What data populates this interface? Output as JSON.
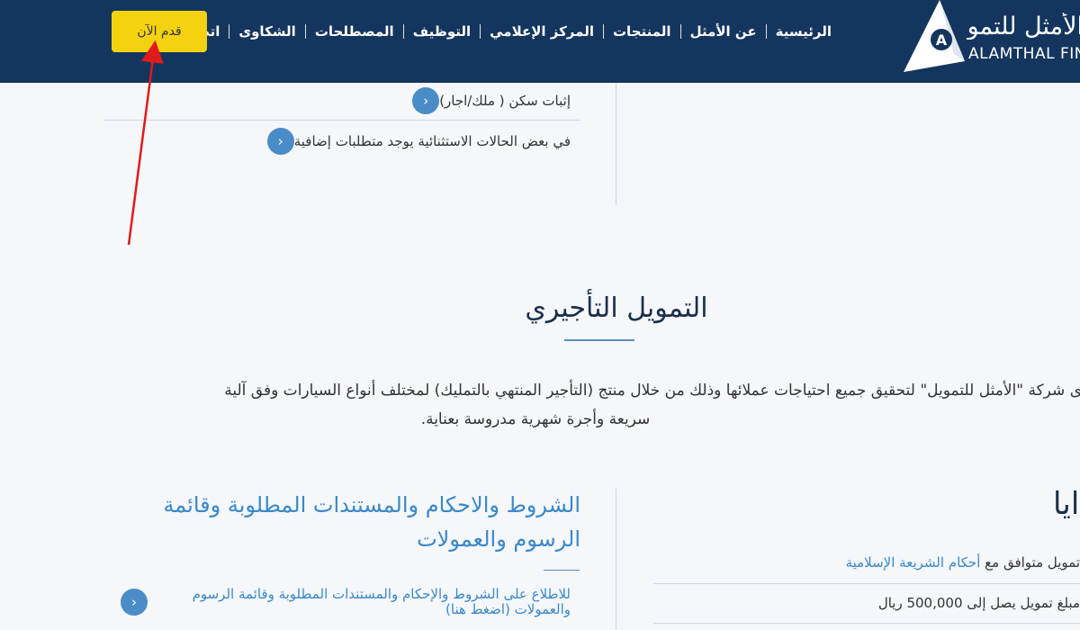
{
  "header": {
    "logo_ar": "الأمثل للتمويل",
    "logo_en": "ALAMTHAL FINANCE",
    "nav": [
      "الرئيسية",
      "عن الأمثل",
      "المنتجات",
      "المركز الإعلامي",
      "التوظيف",
      "المصطلحات",
      "الشكاوى",
      "اتصل بنا"
    ],
    "cta": "قدم الآن"
  },
  "upper_list": [
    "إثبات سكن ( ملك/اجار)",
    "في بعض الحالات الاستثنائية يوجد متطلبات إضافية"
  ],
  "section": {
    "title": "التمويل التأجيري",
    "para_line1": "ى شركة \"الأمثل للتمويل\" لتحقيق جميع احتياجات عملائها وذلك من خلال منتج (التأجير المنتهي بالتمليك) لمختلف أنواع السيارات وفق آلية",
    "para_line2": "سريعة وأجرة شهرية مدروسة بعناية."
  },
  "terms": {
    "title": "الشروط والاحكام والمستندات المطلوبة وقائمة الرسوم والعمولات",
    "link": "للاطلاع على الشروط والإحكام والمستندات المطلوبة وقائمة الرسوم والعمولات (اضغط هنا)"
  },
  "advantages": {
    "title": "ايا",
    "item1_prefix": "تمويل متوافق مع",
    "item1_link": "أحكام الشريعة الإسلامية",
    "item2": "مبلغ تمويل يصل إلى 500,000 ريال"
  },
  "colors": {
    "header_bg": "#14365e",
    "cta_bg": "#f5d20f",
    "accent": "#3a88c8",
    "annotation": "#e01b1b"
  }
}
